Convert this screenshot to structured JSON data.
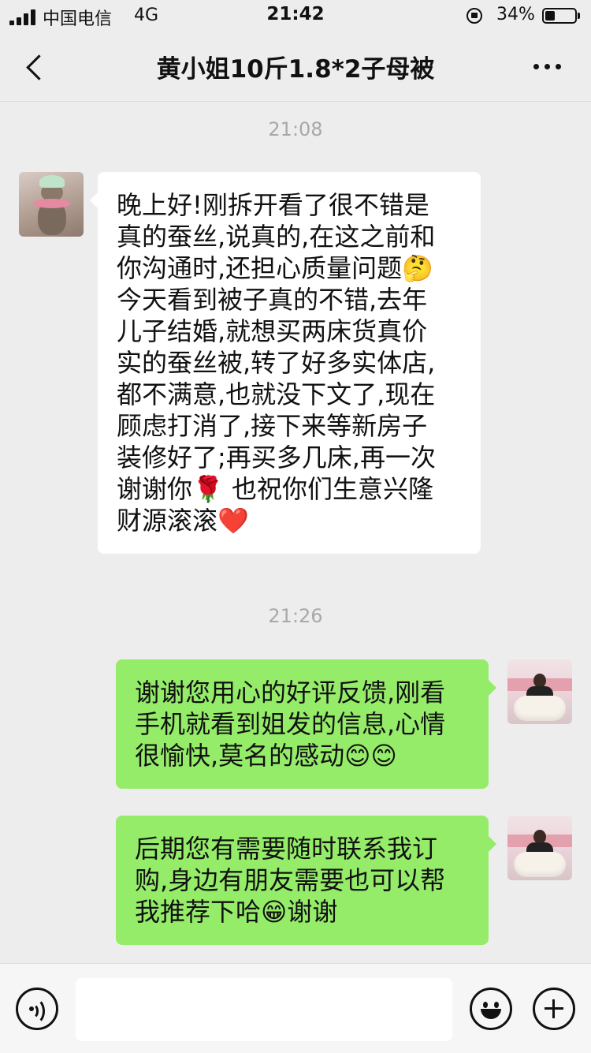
{
  "status_bar": {
    "carrier": "中国电信",
    "network": "4G",
    "time": "21:42",
    "battery_percent_text": "34%",
    "battery_level": 0.34
  },
  "nav": {
    "title": "黄小姐10斤1.8*2子母被",
    "back_icon": "chevron-left-icon",
    "more_icon": "ellipsis-icon"
  },
  "messages": [
    {
      "timestamp": "21:08",
      "sender": "contact",
      "lines": [
        "晚上好!刚拆开看了很不错是",
        "真的蚕丝,说真的,在这之前和",
        "你沟通时,还担心质量问题🤔",
        "今天看到被子真的不错,去年",
        "儿子结婚,就想买两床货真价",
        "实的蚕丝被,转了好多实体店,",
        "都不满意,也就没下文了,现在",
        "顾虑打消了,接下来等新房子",
        "装修好了;再买多几床,再一次",
        "谢谢你🌹 也祝你们生意兴隆",
        "财源滚滚❤️"
      ]
    },
    {
      "timestamp": "21:26",
      "sender": "me",
      "lines": [
        "谢谢您用心的好评反馈,刚看",
        "手机就看到姐发的信息,心情",
        "很愉快,莫名的感动😊😊"
      ]
    },
    {
      "sender": "me",
      "lines": [
        "后期您有需要随时联系我订",
        "购,身边有朋友需要也可以帮",
        "我推荐下哈😁谢谢"
      ]
    }
  ],
  "input_bar": {
    "placeholder": "",
    "voice_icon": "voice-icon",
    "emoji_icon": "emoji-icon",
    "plus_icon": "plus-icon"
  },
  "colors": {
    "background": "#ededed",
    "incoming_bubble": "#ffffff",
    "outgoing_bubble": "#95ec69",
    "timestamp": "#a8a8a8"
  }
}
